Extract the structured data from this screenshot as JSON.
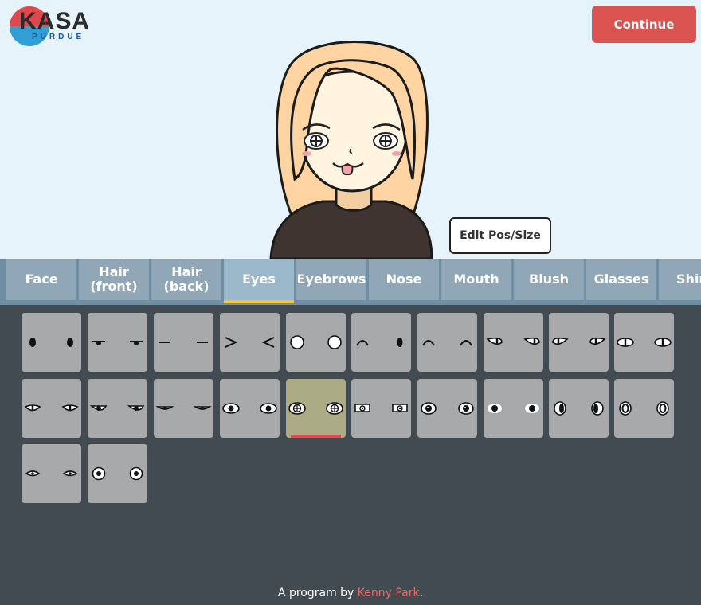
{
  "logo": {
    "title": "KASA",
    "subtitle": "PURDUE"
  },
  "header": {
    "continue_label": "Continue"
  },
  "avatar": {
    "hair_color": "#ffd4a3",
    "skin_color": "#fff4e0",
    "shirt_color": "#3f3430"
  },
  "edit_button": {
    "label": "Edit Pos/Size"
  },
  "tabs": [
    {
      "label": "Face"
    },
    {
      "label": "Hair\n(front)"
    },
    {
      "label": "Hair\n(back)"
    },
    {
      "label": "Eyes",
      "active": true
    },
    {
      "label": "Eyebrows"
    },
    {
      "label": "Nose"
    },
    {
      "label": "Mouth"
    },
    {
      "label": "Blush"
    },
    {
      "label": "Glasses"
    },
    {
      "label": "Shirt"
    }
  ],
  "options": {
    "selected_index": 14,
    "styles": [
      "dot",
      "flat-lid",
      "dash",
      "chevrons",
      "circle",
      "arc-dot",
      "arcs",
      "almond-right",
      "almond-left",
      "almond-center",
      "almond-lower",
      "almond-upper",
      "narrow",
      "almond-pupil",
      "cross-iris",
      "box-iris",
      "round-pupil",
      "round-small",
      "oval-left",
      "oval-ring",
      "teardrop",
      "ring"
    ]
  },
  "colors": {
    "accent": "#d95450",
    "tab_underline": "#f2c33c",
    "panel": "#414b51"
  },
  "footer": {
    "prefix": "A program by ",
    "author": "Kenny Park",
    "suffix": "."
  }
}
